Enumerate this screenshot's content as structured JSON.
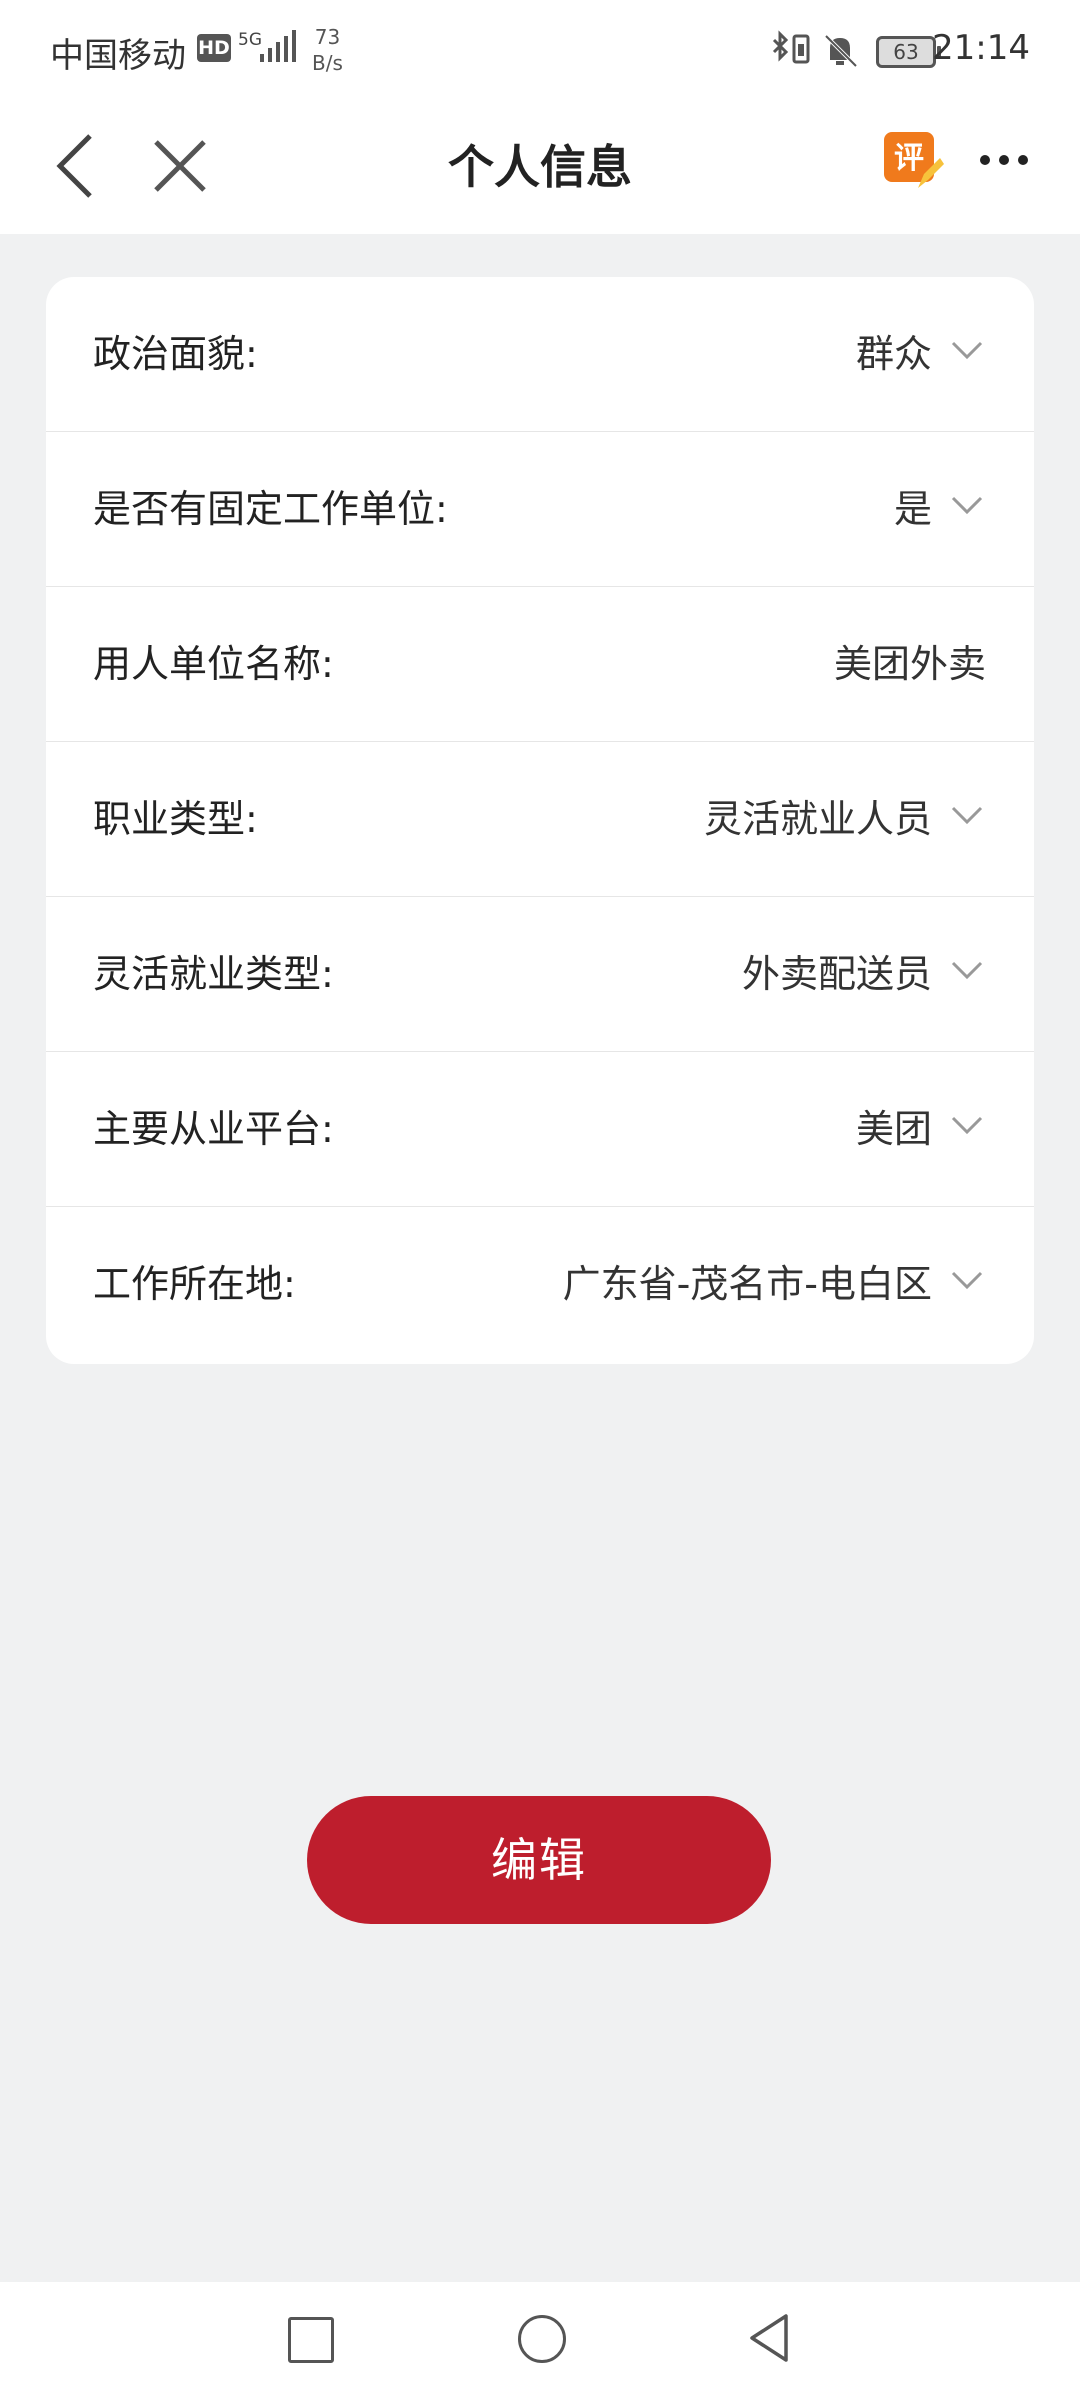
{
  "status_bar": {
    "carrier": "中国移动",
    "hd_badge": "HD",
    "network": "5G",
    "speed_value": "73",
    "speed_unit": "B/s",
    "battery": "63",
    "time": "21:14"
  },
  "nav": {
    "title": "个人信息",
    "rate_badge": "评",
    "back_icon": "chevron-left-icon",
    "close_icon": "close-icon",
    "more_icon": "more-icon"
  },
  "form": {
    "rows": [
      {
        "label": "政治面貌:",
        "value": "群众",
        "dropdown": true
      },
      {
        "label": "是否有固定工作单位:",
        "value": "是",
        "dropdown": true
      },
      {
        "label": "用人单位名称:",
        "value": "美团外卖",
        "dropdown": false
      },
      {
        "label": "职业类型:",
        "value": "灵活就业人员",
        "dropdown": true
      },
      {
        "label": "灵活就业类型:",
        "value": "外卖配送员",
        "dropdown": true
      },
      {
        "label": "主要从业平台:",
        "value": "美团",
        "dropdown": true
      },
      {
        "label": "工作所在地:",
        "value": "广东省-茂名市-电白区",
        "dropdown": true
      }
    ]
  },
  "actions": {
    "edit_label": "编辑"
  },
  "colors": {
    "accent": "#be1e2d",
    "background": "#f0f1f2",
    "card": "#ffffff"
  }
}
